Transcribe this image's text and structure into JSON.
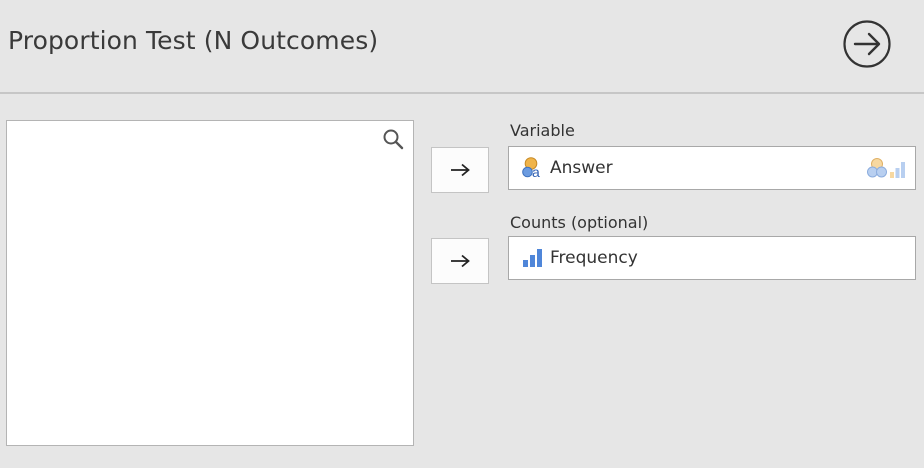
{
  "header": {
    "title": "Proportion Test (N Outcomes)"
  },
  "variables_panel": {
    "items": []
  },
  "targets": {
    "variable": {
      "label": "Variable",
      "value": "Answer",
      "value_icon": "nominal-text-variable-icon",
      "allowed_icons": [
        "nominal-icon",
        "ordinal-icon"
      ]
    },
    "counts": {
      "label": "Counts (optional)",
      "value": "Frequency",
      "value_icon": "continuous-variable-icon"
    }
  },
  "colors": {
    "background": "#e6e6e6",
    "panel": "#ffffff",
    "nominal_orange": "#f0b44a",
    "nominal_blue": "#5b8ed6",
    "continuous_blue": "#4f86d9"
  }
}
